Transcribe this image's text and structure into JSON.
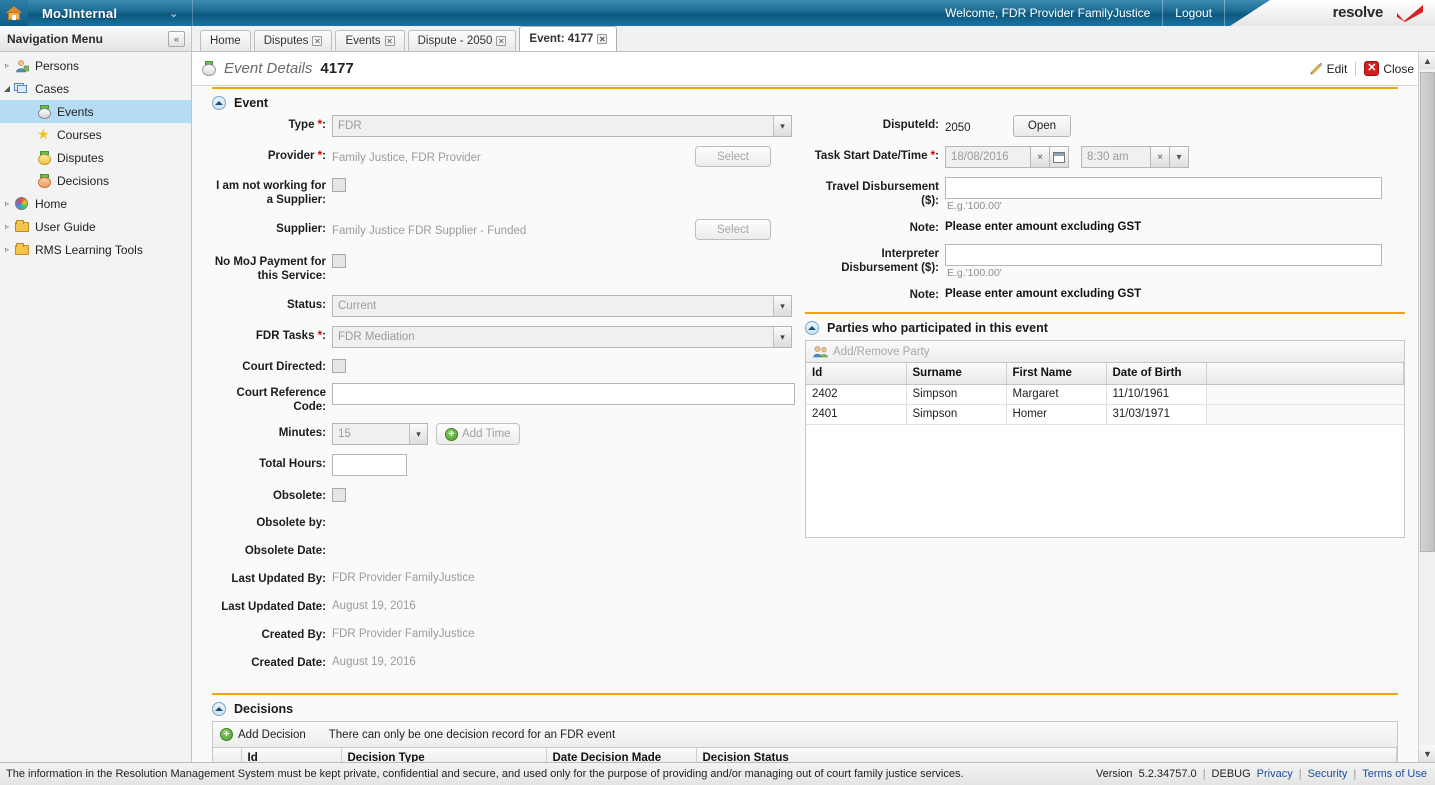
{
  "topbar": {
    "home_icon": "home-icon",
    "app_name": "MoJInternal",
    "chevron": "⌄",
    "welcome": "Welcome, FDR Provider FamilyJustice",
    "logout": "Logout",
    "logo_text": "resolve",
    "logo_mark": "red-check-icon"
  },
  "tabs": [
    {
      "label": "Home",
      "active": false,
      "closable": false
    },
    {
      "label": "Disputes",
      "active": false,
      "closable": true
    },
    {
      "label": "Events",
      "active": false,
      "closable": true
    },
    {
      "label": "Dispute - 2050",
      "active": false,
      "closable": true
    },
    {
      "label": "Event: 4177",
      "active": true,
      "closable": true
    }
  ],
  "nav": {
    "header": "Navigation Menu",
    "collapse_icon": "«",
    "items": [
      {
        "label": "Persons",
        "icon": "person-icon",
        "level": 1,
        "expander": "▹",
        "selected": false
      },
      {
        "label": "Cases",
        "icon": "cases-icon",
        "level": 1,
        "expander": "◢",
        "selected": false
      },
      {
        "label": "Events",
        "icon": "disc-green-icon",
        "level": 2,
        "expander": "",
        "selected": true
      },
      {
        "label": "Courses",
        "icon": "star-icon",
        "level": 2,
        "expander": "",
        "selected": false
      },
      {
        "label": "Disputes",
        "icon": "disc-yellow-icon",
        "level": 2,
        "expander": "",
        "selected": false
      },
      {
        "label": "Decisions",
        "icon": "disc-orange-icon",
        "level": 2,
        "expander": "",
        "selected": false
      },
      {
        "label": "Home",
        "icon": "globe-icon",
        "level": 1,
        "expander": "▹",
        "selected": false
      },
      {
        "label": "User Guide",
        "icon": "folder-icon",
        "level": 1,
        "expander": "▹",
        "selected": false
      },
      {
        "label": "RMS Learning Tools",
        "icon": "folder-icon",
        "level": 1,
        "expander": "▹",
        "selected": false
      }
    ]
  },
  "page": {
    "title": "Event Details",
    "record_id": "4177",
    "edit_label": "Edit",
    "close_label": "Close"
  },
  "event_section": {
    "title": "Event",
    "type_label": "Type",
    "type_value": "FDR",
    "provider_label": "Provider",
    "provider_value": "Family Justice, FDR Provider",
    "provider_select": "Select",
    "not_working_label": "I am not working for a Supplier:",
    "supplier_label": "Supplier:",
    "supplier_value": "Family Justice FDR Supplier - Funded",
    "supplier_select": "Select",
    "no_moj_label": "No MoJ Payment for this Service:",
    "status_label": "Status:",
    "status_value": "Current",
    "fdr_tasks_label": "FDR Tasks",
    "fdr_tasks_value": "FDR Mediation",
    "court_directed_label": "Court Directed:",
    "court_ref_label": "Court Reference Code:",
    "court_ref_value": "",
    "minutes_label": "Minutes:",
    "minutes_value": "15",
    "add_time_label": "Add Time",
    "total_hours_label": "Total Hours:",
    "total_hours_value": "",
    "obsolete_label": "Obsolete:",
    "obsolete_by_label": "Obsolete by:",
    "obsolete_by_value": "",
    "obsolete_date_label": "Obsolete Date:",
    "obsolete_date_value": "",
    "last_updated_by_label": "Last Updated By:",
    "last_updated_by_value": "FDR Provider FamilyJustice",
    "last_updated_date_label": "Last Updated Date:",
    "last_updated_date_value": "August 19, 2016",
    "created_by_label": "Created By:",
    "created_by_value": "FDR Provider FamilyJustice",
    "created_date_label": "Created Date:",
    "created_date_value": "August 19, 2016"
  },
  "right_panel": {
    "dispute_id_label": "DisputeId:",
    "dispute_id_value": "2050",
    "open_label": "Open",
    "task_start_label": "Task Start Date/Time",
    "task_date_value": "18/08/2016",
    "task_time_value": "8:30 am",
    "clear_icon": "×",
    "calendar_icon": "calendar-icon",
    "travel_label": "Travel Disbursement ($):",
    "travel_value": "",
    "travel_hint": "E.g.'100.00'",
    "note_label": "Note:",
    "note_travel": "Please enter amount excluding GST",
    "interpreter_label": "Interpreter Disbursement ($):",
    "interpreter_value": "",
    "interpreter_hint": "E.g.'100.00'",
    "note_interpreter": "Please enter amount excluding GST"
  },
  "parties": {
    "title": "Parties who participated in this event",
    "toolbar_label": "Add/Remove Party",
    "columns": [
      "Id",
      "Surname",
      "First Name",
      "Date of Birth",
      ""
    ],
    "rows": [
      {
        "id": "2402",
        "surname": "Simpson",
        "first_name": "Margaret",
        "dob": "11/10/1961"
      },
      {
        "id": "2401",
        "surname": "Simpson",
        "first_name": "Homer",
        "dob": "31/03/1971"
      }
    ]
  },
  "decisions": {
    "title": "Decisions",
    "add_label": "Add Decision",
    "hint": "There can only be one decision record for an FDR event",
    "columns": [
      "",
      "Id",
      "Decision Type",
      "Date Decision Made",
      "Decision Status"
    ]
  },
  "footer": {
    "disclaimer": "The information in the Resolution Management System must be kept private, confidential and secure, and used only for the purpose of providing and/or managing out of court family justice services.",
    "version_label": "Version",
    "version_value": "5.2.34757.0",
    "debug": "DEBUG",
    "privacy": "Privacy",
    "security": "Security",
    "terms": "Terms of Use"
  },
  "colors": {
    "header_blue": "#1b6a92",
    "accent_orange": "#f0a30a",
    "selection_blue": "#b6dcf5",
    "required_red": "#cc0000",
    "link_blue": "#1a4fa0"
  }
}
